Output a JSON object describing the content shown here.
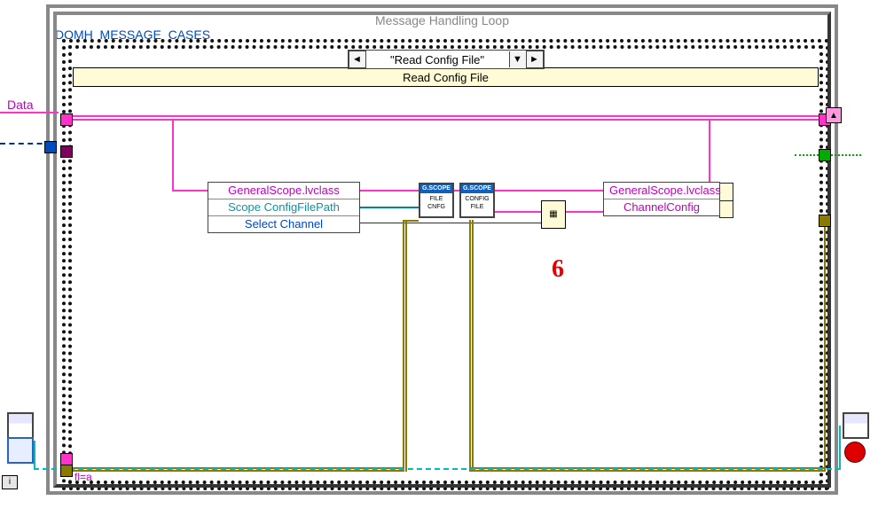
{
  "loop": {
    "title": "Message Handling Loop"
  },
  "case": {
    "label": "DQMH_MESSAGE_CASES",
    "selector_value": "\"Read Config File\"",
    "banner": "Read Config File"
  },
  "external": {
    "data_label": "Data"
  },
  "unbundle": {
    "row0": "GeneralScope.lvclass",
    "row1": "Scope ConfigFilePath",
    "row2": "Select Channel"
  },
  "vi_nodes": {
    "vi1_header": "G.SCOPE",
    "vi1_body": "FILE CNFG",
    "vi2_header": "G.SCOPE",
    "vi2_body": "CONFIG FILE"
  },
  "bundle_out": {
    "row0": "GeneralScope.lvclass",
    "row1": "ChannelConfig"
  },
  "annotation": {
    "mark": "6"
  },
  "misc": {
    "fla": "fl=a",
    "i_label": "i"
  }
}
